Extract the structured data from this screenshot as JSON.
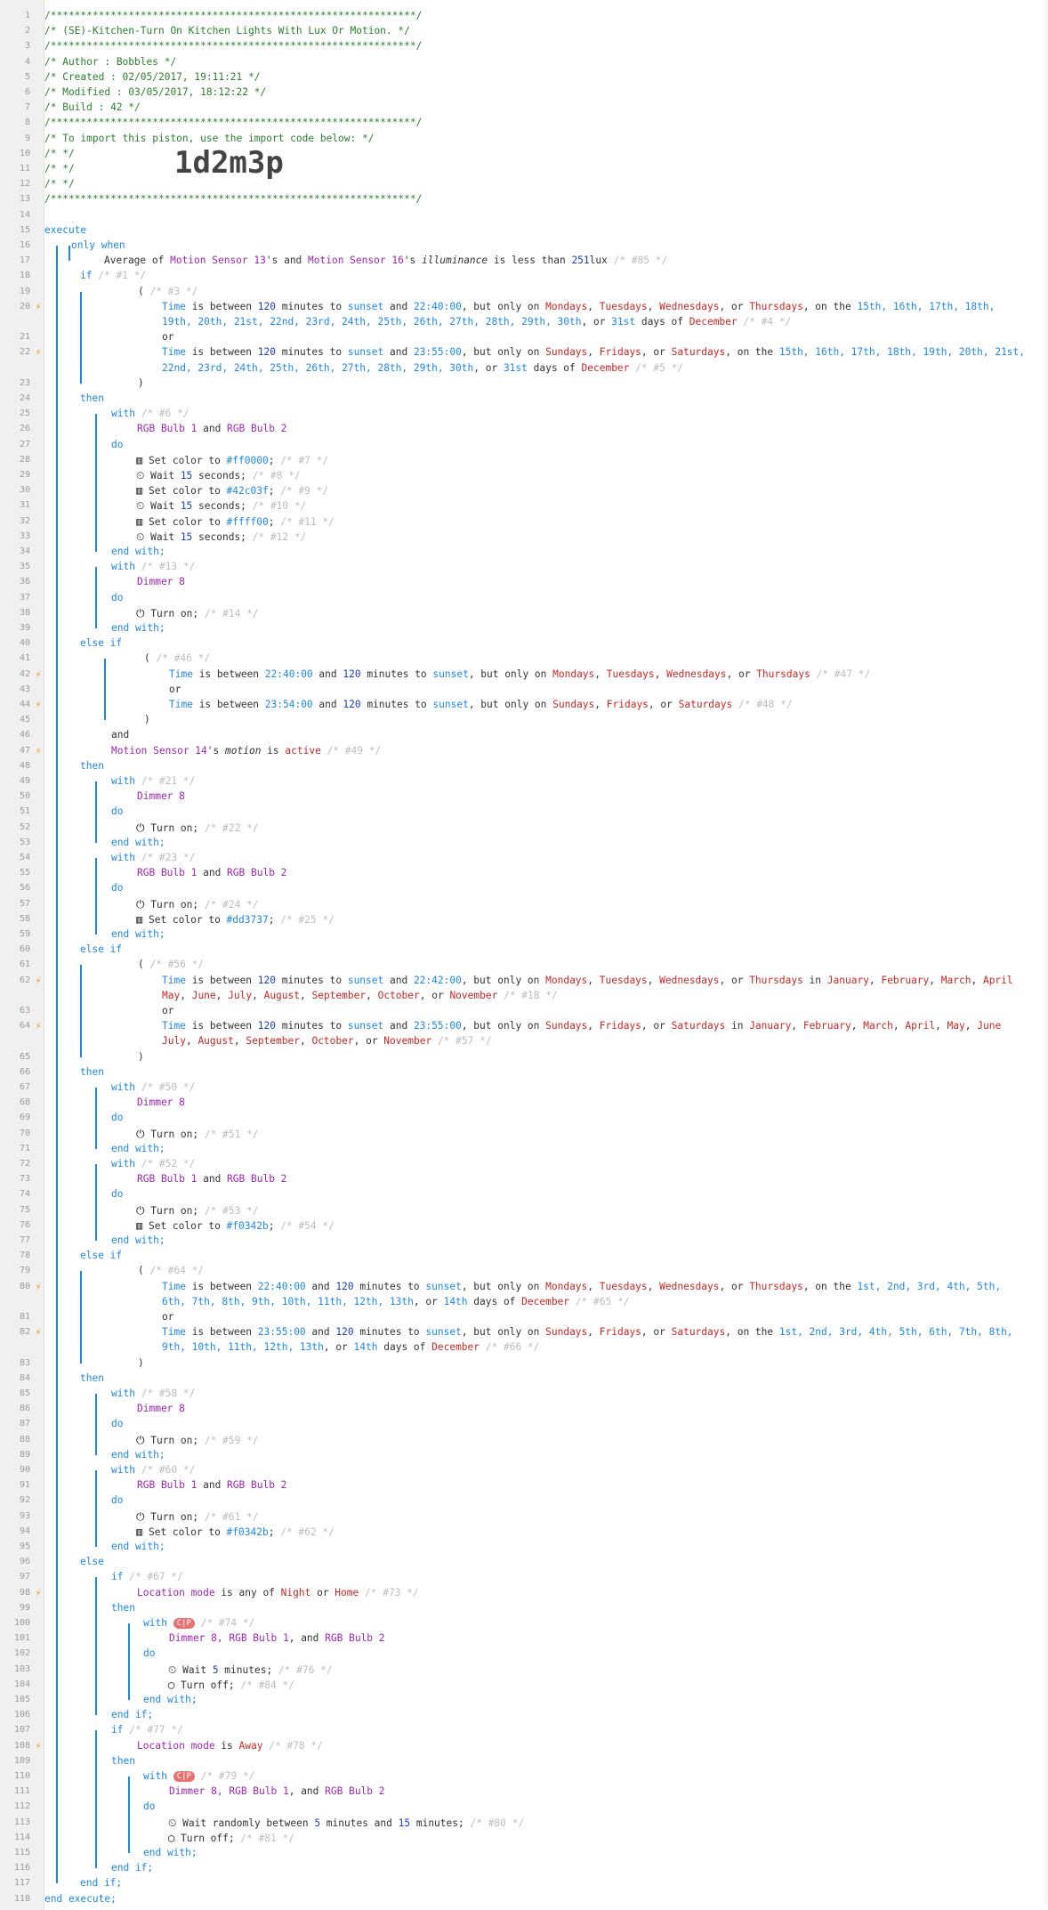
{
  "gutter": {
    "line_numbers": [
      "1",
      "2",
      "3",
      "4",
      "5",
      "6",
      "7",
      "8",
      "9",
      "10",
      "11",
      "12",
      "13",
      "14",
      "15",
      "16",
      "17",
      "18",
      "19",
      "20",
      "21",
      "22",
      "23",
      "24",
      "25",
      "26",
      "27",
      "28",
      "29",
      "30",
      "31",
      "32",
      "33",
      "34",
      "35",
      "36",
      "37",
      "38",
      "39",
      "40",
      "41",
      "42",
      "43",
      "44",
      "45",
      "46",
      "47",
      "48",
      "49",
      "50",
      "51",
      "52",
      "53",
      "54",
      "55",
      "56",
      "57",
      "58",
      "59",
      "60",
      "61",
      "62",
      "63",
      "64",
      "65",
      "66",
      "67",
      "68",
      "69",
      "70",
      "71",
      "72",
      "73",
      "74",
      "75",
      "76",
      "77",
      "78",
      "79",
      "80",
      "81",
      "82",
      "83",
      "84",
      "85",
      "86",
      "87",
      "88",
      "89",
      "90",
      "91",
      "92",
      "93",
      "94",
      "95",
      "96",
      "97",
      "98",
      "99",
      "100",
      "101",
      "102",
      "103",
      "104",
      "105",
      "106",
      "107",
      "108",
      "109",
      "110",
      "111",
      "112",
      "113",
      "114",
      "115",
      "116",
      "117",
      "118"
    ],
    "bolt_icon": "⚡"
  },
  "header": {
    "stars": "/*************************************************************/",
    "title": "/* (SE)-Kitchen-Turn On Kitchen Lights With Lux Or Motion. */",
    "author": "/* Author : Bobbles */",
    "created": "/* Created : 02/05/2017, 19:11:21 */",
    "modified": "/* Modified : 03/05/2017, 18:12:22 */",
    "build": "/* Build : 42 */",
    "import_note": "/* To import this piston, use the import code below: */",
    "empty_comment": "/* */",
    "import_code": "1d2m3p"
  },
  "kw": {
    "execute": "execute",
    "only": "only",
    "when": "when",
    "if": "if",
    "then": "then",
    "with": "with",
    "do": "do",
    "end_with": "end with;",
    "else_if": "else if",
    "else": "else",
    "or": "or",
    "and": "and",
    "end_if": "end if;",
    "end_execute": "end execute;"
  },
  "text": {
    "average_of": "Average of ",
    "s": "'s",
    "s_and": "'s and ",
    "illuminance": "illuminance",
    "is_less_than": " is less than ",
    "lux": "lux",
    "and_sp": " and ",
    "comma_sp": ", ",
    "comma_and_sp": ", and ",
    "is_between": " is between ",
    "minutes_to": " minutes to ",
    "but_only_on": ", but only on ",
    "comma_or_sp": ", or ",
    "on_the": ", on the ",
    "days_of": " days of ",
    "open_paren": "( ",
    "close_paren": ")",
    "in_sp": " in ",
    "set_color_to": "Set color to ",
    "wait": "Wait ",
    "seconds": " seconds;",
    "turn_on": "Turn on;",
    "turn_off": "Turn off;",
    "minutes": " minutes;",
    "wait_randomly": "Wait randomly between ",
    "minutes_and": " minutes and ",
    "motion": "motion",
    "is_sp": " is ",
    "is_any_of": " is any of ",
    "or_sp": " or ",
    "time": "Time",
    "sunset": "sunset",
    "location_mode": "Location mode",
    "semicolon": ";",
    "space": " "
  },
  "values": {
    "n120": "120",
    "n251": "251",
    "n15": "15",
    "n5": "5",
    "t2240": "22:40:00",
    "t2355": "23:55:00",
    "t2242": "22:42:00",
    "t2354": "23:54:00",
    "color_ff0000": "#ff0000",
    "color_42c03f": "#42c03f",
    "color_ffff00": "#ffff00",
    "color_dd3737": "#dd3737",
    "color_f0342b": "#f0342b",
    "active": "active",
    "night": "Night",
    "home": "Home",
    "away": "Away",
    "december": "December"
  },
  "devices": {
    "ms13": "Motion Sensor 13",
    "ms16": "Motion Sensor 16",
    "ms14": "Motion Sensor 14",
    "rgb1": "RGB Bulb 1",
    "rgb2": "RGB Bulb 2",
    "dimmer8": "Dimmer 8",
    "dimmer8_list": "Dimmer 8, ",
    "rgb1_list": "RGB Bulb 1"
  },
  "days": {
    "mon": "Mondays",
    "tue": "Tuesdays",
    "wed": "Wednesdays",
    "thu": "Thursdays",
    "sun": "Sundays",
    "fri": "Fridays",
    "sat": "Saturdays"
  },
  "months": {
    "jan": "January",
    "feb": "February",
    "mar": "March",
    "apr": "April",
    "may": "May",
    "jun": "June",
    "jul": "July",
    "aug": "August",
    "sep": "September",
    "oct": "October",
    "nov": "November"
  },
  "dates": {
    "l20a": "15th, 16th, 17th, 18th,",
    "l20b": "19th, 20th, 21st, 22nd, 23rd, 24th, 25th, 26th, 27th, 28th, 29th, 30th",
    "l22a": "15th, 16th, 17th, 18th, 19th, 20th, 21st,",
    "l22b": "22nd, 23rd, 24th, 25th, 26th, 27th, 28th, 29th, 30th",
    "d31": "31st",
    "l80a": "1st, 2nd, 3rd, 4th, 5th,",
    "l80b": "6th, 7th, 8th, 9th, 10th, 11th, 12th, 13th",
    "l82a": "1st, 2nd, 3rd, 4th, 5th, 6th, 7th, 8th,",
    "l82b": "9th, 10th, 11th, 12th, 13th",
    "d14": "14th"
  },
  "comments": {
    "c85": "/* #85 */",
    "c1": "/* #1 */",
    "c3": "/* #3 */",
    "c4": "/* #4 */",
    "c5": "/* #5 */",
    "c6": "/* #6 */",
    "c7": "/* #7 */",
    "c8": "/* #8 */",
    "c9": "/* #9 */",
    "c10": "/* #10 */",
    "c11": "/* #11 */",
    "c12": "/* #12 */",
    "c13": "/* #13 */",
    "c14": "/* #14 */",
    "c46": "/* #46 */",
    "c47": "/* #47 */",
    "c48": "/* #48 */",
    "c49": "/* #49 */",
    "c21": "/* #21 */",
    "c22": "/* #22 */",
    "c23": "/* #23 */",
    "c24": "/* #24 */",
    "c25": "/* #25 */",
    "c56": "/* #56 */",
    "c18": "/* #18 */",
    "c57": "/* #57 */",
    "c50": "/* #50 */",
    "c51": "/* #51 */",
    "c52": "/* #52 */",
    "c53": "/* #53 */",
    "c54": "/* #54 */",
    "c64": "/* #64 */",
    "c65": "/* #65 */",
    "c66": "/* #66 */",
    "c58": "/* #58 */",
    "c59": "/* #59 */",
    "c60": "/* #60 */",
    "c61": "/* #61 */",
    "c62": "/* #62 */",
    "c67": "/* #67 */",
    "c73": "/* #73 */",
    "c74": "/* #74 */",
    "c76": "/* #76 */",
    "c84": "/* #84 */",
    "c77": "/* #77 */",
    "c78": "/* #78 */",
    "c79": "/* #79 */",
    "c80": "/* #80 */",
    "c81": "/* #81 */"
  },
  "badges": {
    "cip": "C|P"
  },
  "icons": {
    "color_icon": "▥",
    "timer_icon": "⏲",
    "power_icon": "⏻",
    "off_icon": "◯"
  },
  "colors": {
    "keyword": "#1e88e5",
    "comment": "#2e7d32",
    "device": "#9c27b0",
    "number": "#1e3fb5",
    "value": "#c62828",
    "bolt": "#f28a1e",
    "badge": "#e57373"
  }
}
